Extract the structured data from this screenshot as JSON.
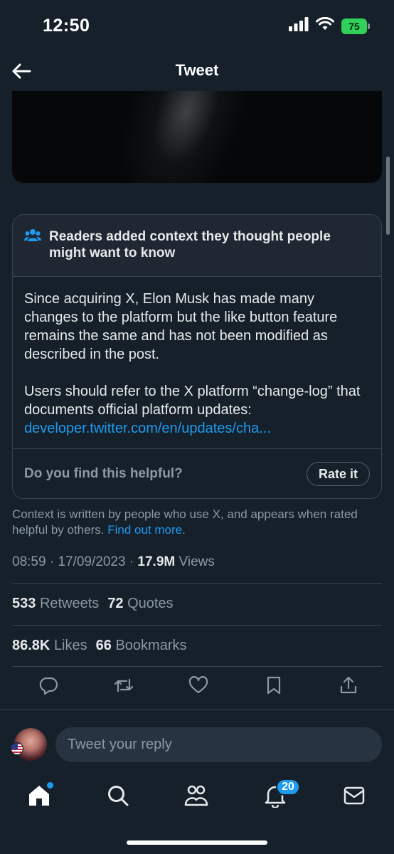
{
  "status_bar": {
    "time": "12:50",
    "battery": "75",
    "icons": [
      "signal-icon",
      "wifi-icon",
      "battery-icon"
    ]
  },
  "header": {
    "title": "Tweet",
    "back_icon": "back-arrow-icon"
  },
  "community_note": {
    "title": "Readers added context they thought people might want to know",
    "paragraph1": "Since acquiring X, Elon Musk has made many changes to the platform but the like button feature remains the same and has not been modified as described in the post.",
    "paragraph2": "Users should refer to the X platform “change-log” that documents official platform updates:",
    "link": "developer.twitter.com/en/updates/cha...",
    "question": "Do you find this helpful?",
    "rate_button": "Rate it"
  },
  "context_disclaimer": {
    "text": "Context is written by people who use X, and appears when rated helpful by others.",
    "link": "Find out more",
    "end": "."
  },
  "meta": {
    "time": "08:59",
    "date": "17/09/2023",
    "views_count": "17.9M",
    "views_label": "Views",
    "separator": "·"
  },
  "stats": {
    "retweets_count": "533",
    "retweets_label": "Retweets",
    "quotes_count": "72",
    "quotes_label": "Quotes",
    "likes_count": "86.8K",
    "likes_label": "Likes",
    "bookmarks_count": "66",
    "bookmarks_label": "Bookmarks"
  },
  "actions": [
    "reply-icon",
    "retweet-icon",
    "like-icon",
    "bookmark-icon",
    "share-icon"
  ],
  "reply": {
    "placeholder": "Tweet your reply"
  },
  "tabbar": {
    "items": [
      "home-icon",
      "search-icon",
      "communities-icon",
      "notifications-icon",
      "messages-icon"
    ],
    "notification_badge": "20"
  },
  "colors": {
    "background": "#15202b",
    "accent": "#1d9bf0",
    "secondary_text": "#8b98a5",
    "border": "#38444d"
  }
}
